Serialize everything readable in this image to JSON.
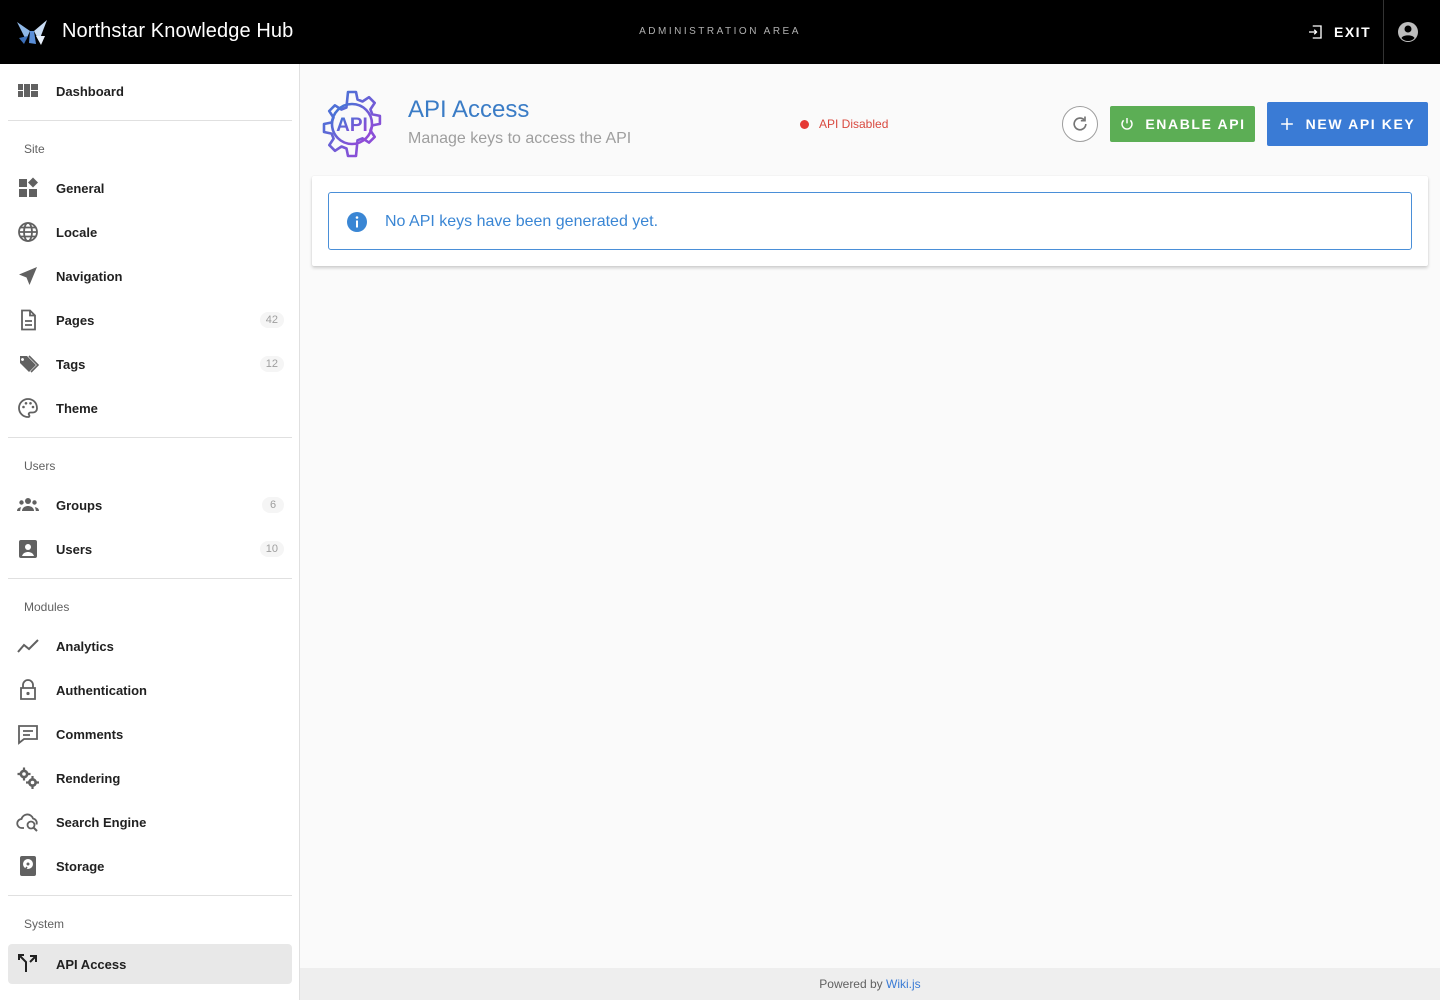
{
  "header": {
    "app_title": "Northstar Knowledge Hub",
    "area_label": "ADMINISTRATION AREA",
    "exit_label": "EXIT"
  },
  "sidebar": {
    "dashboard": {
      "label": "Dashboard",
      "icon": "dashboard-icon"
    },
    "sections": [
      {
        "title": "Site",
        "items": [
          {
            "label": "General",
            "icon": "widgets-icon"
          },
          {
            "label": "Locale",
            "icon": "globe-icon"
          },
          {
            "label": "Navigation",
            "icon": "navigation-icon"
          },
          {
            "label": "Pages",
            "icon": "page-icon",
            "count": "42"
          },
          {
            "label": "Tags",
            "icon": "tags-icon",
            "count": "12"
          },
          {
            "label": "Theme",
            "icon": "palette-icon"
          }
        ]
      },
      {
        "title": "Users",
        "items": [
          {
            "label": "Groups",
            "icon": "groups-icon",
            "count": "6"
          },
          {
            "label": "Users",
            "icon": "account-box-icon",
            "count": "10"
          }
        ]
      },
      {
        "title": "Modules",
        "items": [
          {
            "label": "Analytics",
            "icon": "chart-line-icon"
          },
          {
            "label": "Authentication",
            "icon": "lock-icon"
          },
          {
            "label": "Comments",
            "icon": "comment-icon"
          },
          {
            "label": "Rendering",
            "icon": "cogs-icon"
          },
          {
            "label": "Search Engine",
            "icon": "cloud-search-icon"
          },
          {
            "label": "Storage",
            "icon": "harddisk-icon"
          }
        ]
      },
      {
        "title": "System",
        "items": [
          {
            "label": "API Access",
            "icon": "api-icon",
            "active": true
          }
        ]
      }
    ]
  },
  "main": {
    "title": "API Access",
    "subtitle": "Manage keys to access the API",
    "icon_text": "API",
    "status": "API Disabled",
    "enable_label": "ENABLE API",
    "new_key_label": "NEW API KEY",
    "empty_message": "No API keys have been generated yet."
  },
  "footer": {
    "prefix": "Powered by",
    "link": "Wiki.js"
  },
  "colors": {
    "accent_blue": "#3a7bd5",
    "enable_green": "#5cae55",
    "status_red": "#e53935"
  }
}
